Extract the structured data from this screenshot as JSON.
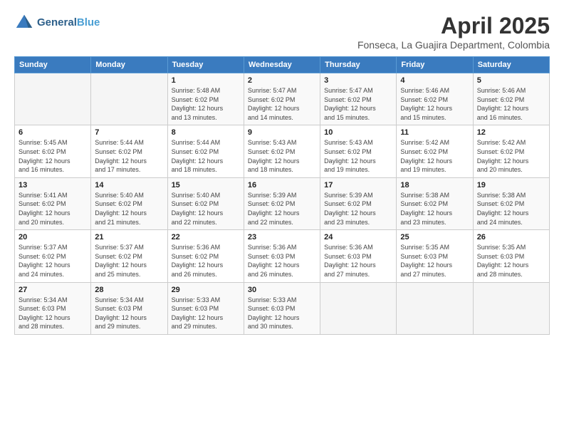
{
  "header": {
    "logo_line1": "General",
    "logo_line2": "Blue",
    "month": "April 2025",
    "location": "Fonseca, La Guajira Department, Colombia"
  },
  "days_of_week": [
    "Sunday",
    "Monday",
    "Tuesday",
    "Wednesday",
    "Thursday",
    "Friday",
    "Saturday"
  ],
  "weeks": [
    [
      {
        "day": "",
        "info": ""
      },
      {
        "day": "",
        "info": ""
      },
      {
        "day": "1",
        "info": "Sunrise: 5:48 AM\nSunset: 6:02 PM\nDaylight: 12 hours\nand 13 minutes."
      },
      {
        "day": "2",
        "info": "Sunrise: 5:47 AM\nSunset: 6:02 PM\nDaylight: 12 hours\nand 14 minutes."
      },
      {
        "day": "3",
        "info": "Sunrise: 5:47 AM\nSunset: 6:02 PM\nDaylight: 12 hours\nand 15 minutes."
      },
      {
        "day": "4",
        "info": "Sunrise: 5:46 AM\nSunset: 6:02 PM\nDaylight: 12 hours\nand 15 minutes."
      },
      {
        "day": "5",
        "info": "Sunrise: 5:46 AM\nSunset: 6:02 PM\nDaylight: 12 hours\nand 16 minutes."
      }
    ],
    [
      {
        "day": "6",
        "info": "Sunrise: 5:45 AM\nSunset: 6:02 PM\nDaylight: 12 hours\nand 16 minutes."
      },
      {
        "day": "7",
        "info": "Sunrise: 5:44 AM\nSunset: 6:02 PM\nDaylight: 12 hours\nand 17 minutes."
      },
      {
        "day": "8",
        "info": "Sunrise: 5:44 AM\nSunset: 6:02 PM\nDaylight: 12 hours\nand 18 minutes."
      },
      {
        "day": "9",
        "info": "Sunrise: 5:43 AM\nSunset: 6:02 PM\nDaylight: 12 hours\nand 18 minutes."
      },
      {
        "day": "10",
        "info": "Sunrise: 5:43 AM\nSunset: 6:02 PM\nDaylight: 12 hours\nand 19 minutes."
      },
      {
        "day": "11",
        "info": "Sunrise: 5:42 AM\nSunset: 6:02 PM\nDaylight: 12 hours\nand 19 minutes."
      },
      {
        "day": "12",
        "info": "Sunrise: 5:42 AM\nSunset: 6:02 PM\nDaylight: 12 hours\nand 20 minutes."
      }
    ],
    [
      {
        "day": "13",
        "info": "Sunrise: 5:41 AM\nSunset: 6:02 PM\nDaylight: 12 hours\nand 20 minutes."
      },
      {
        "day": "14",
        "info": "Sunrise: 5:40 AM\nSunset: 6:02 PM\nDaylight: 12 hours\nand 21 minutes."
      },
      {
        "day": "15",
        "info": "Sunrise: 5:40 AM\nSunset: 6:02 PM\nDaylight: 12 hours\nand 22 minutes."
      },
      {
        "day": "16",
        "info": "Sunrise: 5:39 AM\nSunset: 6:02 PM\nDaylight: 12 hours\nand 22 minutes."
      },
      {
        "day": "17",
        "info": "Sunrise: 5:39 AM\nSunset: 6:02 PM\nDaylight: 12 hours\nand 23 minutes."
      },
      {
        "day": "18",
        "info": "Sunrise: 5:38 AM\nSunset: 6:02 PM\nDaylight: 12 hours\nand 23 minutes."
      },
      {
        "day": "19",
        "info": "Sunrise: 5:38 AM\nSunset: 6:02 PM\nDaylight: 12 hours\nand 24 minutes."
      }
    ],
    [
      {
        "day": "20",
        "info": "Sunrise: 5:37 AM\nSunset: 6:02 PM\nDaylight: 12 hours\nand 24 minutes."
      },
      {
        "day": "21",
        "info": "Sunrise: 5:37 AM\nSunset: 6:02 PM\nDaylight: 12 hours\nand 25 minutes."
      },
      {
        "day": "22",
        "info": "Sunrise: 5:36 AM\nSunset: 6:02 PM\nDaylight: 12 hours\nand 26 minutes."
      },
      {
        "day": "23",
        "info": "Sunrise: 5:36 AM\nSunset: 6:03 PM\nDaylight: 12 hours\nand 26 minutes."
      },
      {
        "day": "24",
        "info": "Sunrise: 5:36 AM\nSunset: 6:03 PM\nDaylight: 12 hours\nand 27 minutes."
      },
      {
        "day": "25",
        "info": "Sunrise: 5:35 AM\nSunset: 6:03 PM\nDaylight: 12 hours\nand 27 minutes."
      },
      {
        "day": "26",
        "info": "Sunrise: 5:35 AM\nSunset: 6:03 PM\nDaylight: 12 hours\nand 28 minutes."
      }
    ],
    [
      {
        "day": "27",
        "info": "Sunrise: 5:34 AM\nSunset: 6:03 PM\nDaylight: 12 hours\nand 28 minutes."
      },
      {
        "day": "28",
        "info": "Sunrise: 5:34 AM\nSunset: 6:03 PM\nDaylight: 12 hours\nand 29 minutes."
      },
      {
        "day": "29",
        "info": "Sunrise: 5:33 AM\nSunset: 6:03 PM\nDaylight: 12 hours\nand 29 minutes."
      },
      {
        "day": "30",
        "info": "Sunrise: 5:33 AM\nSunset: 6:03 PM\nDaylight: 12 hours\nand 30 minutes."
      },
      {
        "day": "",
        "info": ""
      },
      {
        "day": "",
        "info": ""
      },
      {
        "day": "",
        "info": ""
      }
    ]
  ]
}
